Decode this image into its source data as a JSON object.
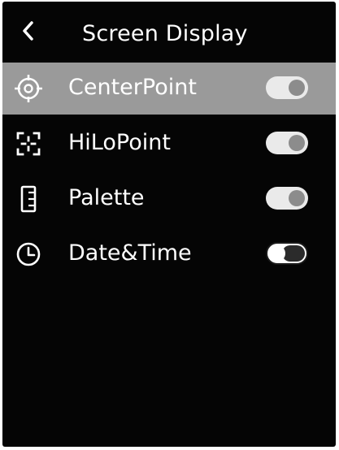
{
  "header": {
    "title": "Screen Display",
    "back_icon": "chevron-left-icon"
  },
  "colors": {
    "background": "#050505",
    "selected_row": "#9a9a9a",
    "text": "#ffffff",
    "toggle_on_track": "#eaeaea",
    "toggle_on_knob": "#8c8c8c"
  },
  "items": [
    {
      "label": "CenterPoint",
      "icon": "crosshair-icon",
      "enabled": true,
      "selected": true
    },
    {
      "label": "HiLoPoint",
      "icon": "focus-brackets-icon",
      "enabled": true,
      "selected": false
    },
    {
      "label": "Palette",
      "icon": "palette-bar-icon",
      "enabled": true,
      "selected": false
    },
    {
      "label": "Date&Time",
      "icon": "clock-icon",
      "enabled": false,
      "selected": false
    }
  ]
}
